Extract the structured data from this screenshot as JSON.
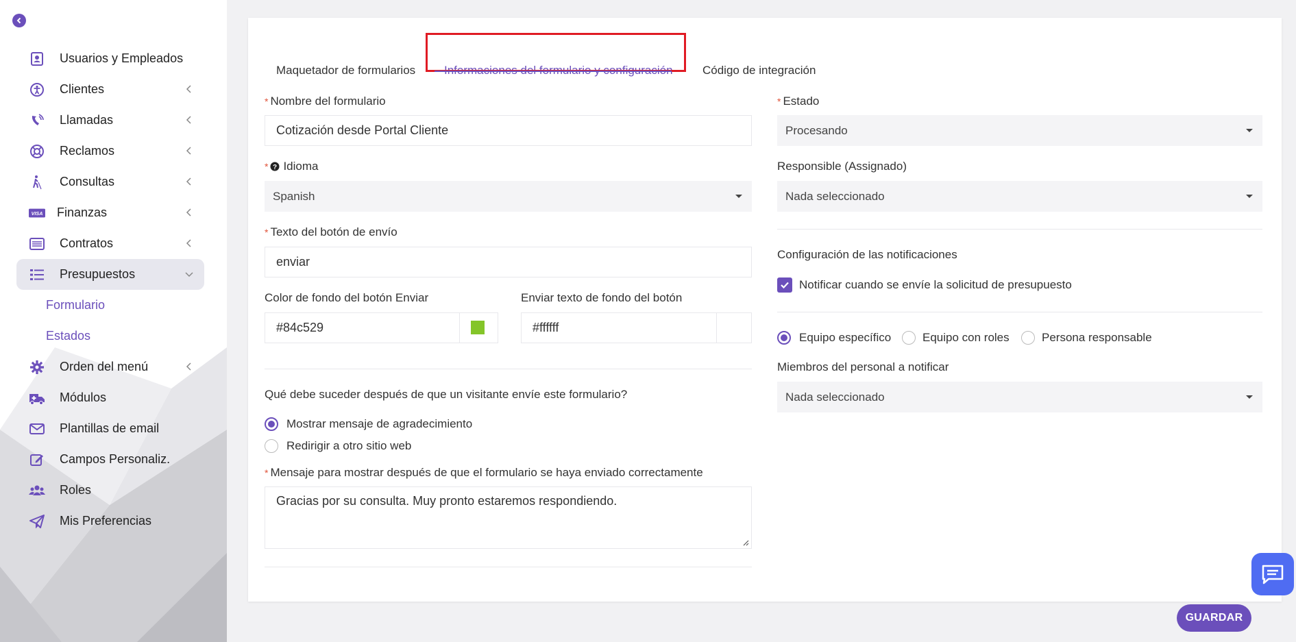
{
  "sidebar": {
    "items": [
      {
        "label": "Usuarios y Empleados"
      },
      {
        "label": "Clientes"
      },
      {
        "label": "Llamadas"
      },
      {
        "label": "Reclamos"
      },
      {
        "label": "Consultas"
      },
      {
        "label": "Finanzas"
      },
      {
        "label": "Contratos"
      },
      {
        "label": "Presupuestos"
      },
      {
        "label": "Orden del menú"
      },
      {
        "label": "Módulos"
      },
      {
        "label": "Plantillas de email"
      },
      {
        "label": "Campos Personaliz."
      },
      {
        "label": "Roles"
      },
      {
        "label": "Mis Preferencias"
      }
    ],
    "subitems": [
      {
        "label": "Formulario"
      },
      {
        "label": "Estados"
      }
    ],
    "visa_text": "VISA"
  },
  "tabs": [
    {
      "label": "Maquetador de formularios"
    },
    {
      "label": "Informaciones del formulario y configuración"
    },
    {
      "label": "Código de integración"
    }
  ],
  "form": {
    "name_label": "Nombre del formulario",
    "name_value": "Cotización desde Portal Cliente",
    "language_label": "Idioma",
    "language_value": "Spanish",
    "submit_text_label": "Texto del botón de envío",
    "submit_text_value": "enviar",
    "bg_color_label": "Color de fondo del botón Enviar",
    "bg_color_value": "#84c529",
    "text_color_label": "Enviar texto de fondo del botón",
    "text_color_value": "#ffffff",
    "after_submit_question": "Qué debe suceder después de que un visitante envíe este formulario?",
    "option_thanks": "Mostrar mensaje de agradecimiento",
    "option_redirect": "Redirigir a otro sitio web",
    "message_label": "Mensaje para mostrar después de que el formulario se haya enviado correctamente",
    "message_value": "Gracias por su consulta. Muy pronto estaremos respondiendo.",
    "status_label": "Estado",
    "status_value": "Procesando",
    "responsible_label": "Responsible (Assignado)",
    "responsible_value": "Nada seleccionado",
    "notif_title": "Configuración de las notificaciones",
    "notif_checkbox_label": "Notificar cuando se envíe la solicitud de presupuesto",
    "radio_team": "Equipo específico",
    "radio_roles": "Equipo con roles",
    "radio_person": "Persona responsable",
    "staff_label": "Miembros del personal a notificar",
    "staff_value": "Nada seleccionado",
    "required_mark": "*"
  },
  "actions": {
    "save_label": "GUARDAR"
  },
  "colors": {
    "accent": "#6b4fbb",
    "swatch_green": "#84c529",
    "chat": "#4f6cf2",
    "highlight": "#e01b24"
  }
}
